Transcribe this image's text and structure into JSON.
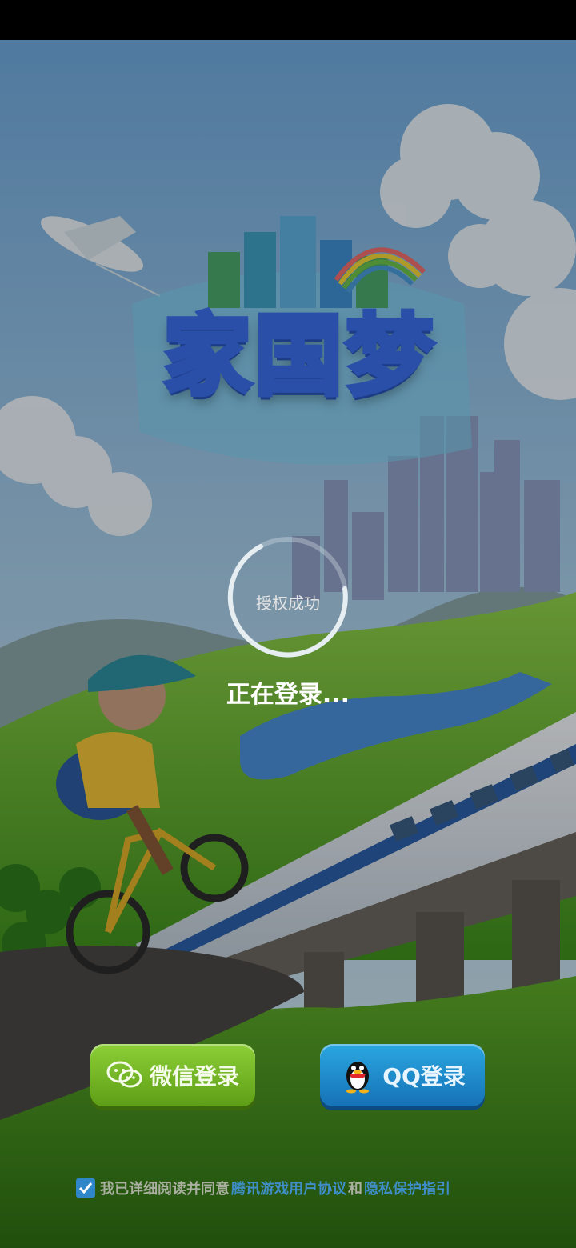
{
  "app": {
    "title": "家国梦"
  },
  "logo": {
    "text": "家国梦"
  },
  "status": {
    "auth": "授权成功",
    "login": "正在登录..."
  },
  "buttons": {
    "wechat_label": "微信登录",
    "qq_label": "QQ登录"
  },
  "agreement": {
    "checked": true,
    "prefix": "我已详细阅读并同意",
    "link1": "腾讯游戏用户协议",
    "and": "和",
    "link2": "隐私保护指引"
  },
  "colors": {
    "wechat_green": "#6cb31f",
    "qq_blue": "#1f8ccb",
    "link_blue": "#3f8ec8",
    "logo_yellow": "#f3b21e"
  }
}
